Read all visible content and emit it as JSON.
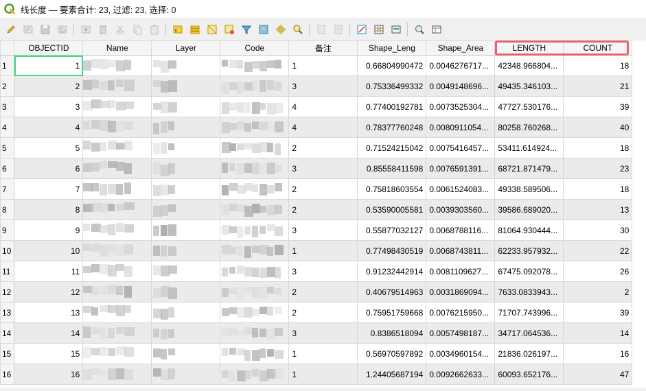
{
  "window": {
    "title": "线长度 — 要素合计: 23, 过滤: 23, 选择: 0"
  },
  "toolbar": {
    "buttons": [
      {
        "icon": "pencil-edit-icon",
        "enabled": true
      },
      {
        "icon": "multi-edit-icon",
        "enabled": false
      },
      {
        "icon": "save-edits-icon",
        "enabled": false
      },
      {
        "icon": "reload-table-icon",
        "enabled": false
      },
      {
        "icon": "add-feature-icon",
        "enabled": false
      },
      {
        "icon": "delete-feature-icon",
        "enabled": false
      },
      {
        "icon": "cut-icon",
        "enabled": false
      },
      {
        "icon": "copy-icon",
        "enabled": false
      },
      {
        "icon": "paste-icon",
        "enabled": false
      },
      {
        "icon": "select-by-expression-icon",
        "enabled": true
      },
      {
        "icon": "select-all-icon",
        "enabled": true
      },
      {
        "icon": "invert-selection-icon",
        "enabled": true
      },
      {
        "icon": "deselect-all-icon",
        "enabled": true
      },
      {
        "icon": "filter-icon",
        "enabled": true
      },
      {
        "icon": "move-selection-to-top-icon",
        "enabled": true
      },
      {
        "icon": "pan-to-selection-icon",
        "enabled": true
      },
      {
        "icon": "zoom-to-selection-icon",
        "enabled": true
      },
      {
        "icon": "new-field-icon",
        "enabled": false
      },
      {
        "icon": "delete-field-icon",
        "enabled": false
      },
      {
        "icon": "field-calculator-icon",
        "enabled": true
      },
      {
        "icon": "conditional-formatting-icon",
        "enabled": true
      },
      {
        "icon": "actions-icon",
        "enabled": true
      },
      {
        "icon": "dock-table-icon",
        "enabled": true
      },
      {
        "icon": "table-view-icon",
        "enabled": true
      }
    ]
  },
  "table": {
    "columns": [
      "OBJECTID",
      "Name",
      "Layer",
      "Code",
      "备注",
      "Shape_Leng",
      "Shape_Area",
      "LENGTH",
      "COUNT"
    ],
    "rows": [
      {
        "n": "1",
        "id": "1",
        "note": "1",
        "leng": "0.66804990472",
        "area": "0.0046276717...",
        "length": "42348.966804...",
        "count": "18"
      },
      {
        "n": "2",
        "id": "2",
        "note": "3",
        "leng": "0.75336499332",
        "area": "0.0049148696...",
        "length": "49435.346103...",
        "count": "21"
      },
      {
        "n": "3",
        "id": "3",
        "note": "4",
        "leng": "0.77400192781",
        "area": "0.0073525304...",
        "length": "47727.530176...",
        "count": "39"
      },
      {
        "n": "4",
        "id": "4",
        "note": "4",
        "leng": "0.78377760248",
        "area": "0.0080911054...",
        "length": "80258.760268...",
        "count": "40"
      },
      {
        "n": "5",
        "id": "5",
        "note": "2",
        "leng": "0.71524215042",
        "area": "0.0075416457...",
        "length": "53411.614924...",
        "count": "18"
      },
      {
        "n": "6",
        "id": "6",
        "note": "3",
        "leng": "0.85558411598",
        "area": "0.0076591391...",
        "length": "68721.871479...",
        "count": "23"
      },
      {
        "n": "7",
        "id": "7",
        "note": "2",
        "leng": "0.75818603554",
        "area": "0.0061524083...",
        "length": "49338.589506...",
        "count": "18"
      },
      {
        "n": "8",
        "id": "8",
        "note": "2",
        "leng": "0.53590005581",
        "area": "0.0039303560...",
        "length": "39586.689020...",
        "count": "13"
      },
      {
        "n": "9",
        "id": "9",
        "note": "3",
        "leng": "0.55877032127",
        "area": "0.0068788116...",
        "length": "81064.930444...",
        "count": "30"
      },
      {
        "n": "10",
        "id": "10",
        "note": "1",
        "leng": "0.77498430519",
        "area": "0.0068743811...",
        "length": "62233.957932...",
        "count": "22"
      },
      {
        "n": "11",
        "id": "11",
        "note": "3",
        "leng": "0.91232442914",
        "area": "0.0081109627...",
        "length": "67475.092078...",
        "count": "26"
      },
      {
        "n": "12",
        "id": "12",
        "note": "2",
        "leng": "0.40679514963",
        "area": "0.0031869094...",
        "length": "7633.0833943...",
        "count": "2"
      },
      {
        "n": "13",
        "id": "13",
        "note": "2",
        "leng": "0.75951759668",
        "area": "0.0076215950...",
        "length": "71707.743996...",
        "count": "39"
      },
      {
        "n": "14",
        "id": "14",
        "note": "3",
        "leng": "0.8386518094",
        "area": "0.0057498187...",
        "length": "34717.064536...",
        "count": "14"
      },
      {
        "n": "15",
        "id": "15",
        "note": "1",
        "leng": "0.56970597892",
        "area": "0.0034960154...",
        "length": "21836.026197...",
        "count": "16"
      },
      {
        "n": "16",
        "id": "16",
        "note": "1",
        "leng": "1.24405687194",
        "area": "0.0092662633...",
        "length": "60093.652176...",
        "count": "47"
      }
    ]
  },
  "colors": {
    "highlight": "#e8606f",
    "current_cell": "#3ddc84",
    "alt_row": "#ebebeb"
  }
}
